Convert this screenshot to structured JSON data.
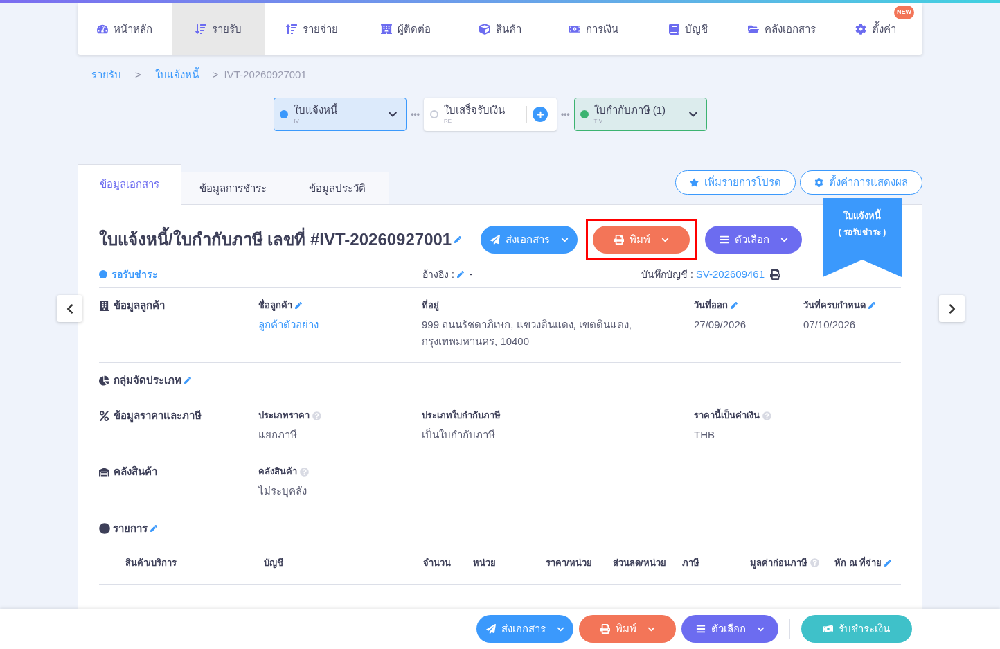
{
  "nav": {
    "items": [
      {
        "label": "หน้าหลัก",
        "selected": false
      },
      {
        "label": "รายรับ",
        "selected": true
      },
      {
        "label": "รายจ่าย",
        "selected": false
      },
      {
        "label": "ผู้ติดต่อ",
        "selected": false
      },
      {
        "label": "สินค้า",
        "selected": false
      },
      {
        "label": "การเงิน",
        "selected": false
      },
      {
        "label": "บัญชี",
        "selected": false
      },
      {
        "label": "คลังเอกสาร",
        "selected": false
      },
      {
        "label": "ตั้งค่า",
        "selected": false,
        "badge": "NEW"
      }
    ]
  },
  "breadcrumb": [
    {
      "label": "รายรับ",
      "kind": "link"
    },
    {
      "separator": ">",
      "label": "ใบแจ้งหนี้",
      "kind": "link"
    },
    {
      "separator": ">",
      "label": "IVT-20260927001",
      "kind": "current"
    }
  ],
  "doc_flow": [
    {
      "label": "ใบแจ้งหนี้",
      "code": "IV",
      "kind": "dropdown",
      "done": true,
      "color": "#3b99fc"
    },
    {
      "connector": "•••",
      "label": "ใบเสร็จรับเงิน",
      "code": "RE",
      "kind": "add",
      "done": false,
      "color": "#c8ccd8"
    },
    {
      "connector": "•••",
      "label": "ใบกำกับภาษี (1)",
      "code": "TIV",
      "kind": "dropdown",
      "done": true,
      "color": "#3cb371"
    }
  ],
  "tabs": [
    {
      "label": "ข้อมูลเอกสาร",
      "selected": true
    },
    {
      "label": "ข้อมูลการชำระ",
      "selected": false
    },
    {
      "label": "ข้อมูลประวัติ",
      "selected": false
    }
  ],
  "top_actions": [
    {
      "label": "เพิ่มรายการโปรด"
    },
    {
      "label": "ตั้งค่าการแสดงผล"
    }
  ],
  "ribbon": {
    "title": "ใบแจ้งหนี้",
    "status": "( รอรับชำระ )"
  },
  "document": {
    "title": "ใบแจ้งหนี้/ใบกำกับภาษี เลขที่ #IVT-20260927001",
    "actions": [
      {
        "label": "ส่งเอกสาร",
        "kind": "send",
        "highlighted": false
      },
      {
        "label": "พิมพ์",
        "kind": "print",
        "highlighted": true
      },
      {
        "label": "ตัวเลือก",
        "kind": "options",
        "highlighted": false
      }
    ],
    "status": {
      "label": "รอรับชำระ",
      "color": "#3b99fc"
    },
    "reference": {
      "label": "อ้างอิง :",
      "value": "-"
    },
    "ledger": {
      "label": "บันทึกบัญชี :",
      "value": "SV-202609461"
    }
  },
  "sections": [
    {
      "title": "ข้อมูลลูกค้า",
      "editable": false,
      "fields": [
        {
          "label": "ชื่อลูกค้า",
          "value": "ลูกค้าตัวอย่าง",
          "editable": true,
          "help": false,
          "link": true
        },
        {
          "label": "ที่อยู่",
          "value": "999 ถนนรัชดาภิเษก, แขวงดินแดง, เขตดินแดง, กรุงเทพมหานคร, 10400",
          "editable": false,
          "help": false,
          "link": false
        },
        {
          "label": "วันที่ออก",
          "value": "27/09/2026",
          "editable": true,
          "help": false,
          "link": false
        },
        {
          "label": "วันที่ครบกำหนด",
          "value": "07/10/2026",
          "editable": true,
          "help": false,
          "link": false
        }
      ]
    },
    {
      "title": "กลุ่มจัดประเภท",
      "editable": true
    },
    {
      "title": "ข้อมูลราคาและภาษี",
      "editable": false,
      "fields": [
        {
          "label": "ประเภทราคา",
          "value": "แยกภาษี",
          "editable": false,
          "help": true,
          "link": false
        },
        {
          "label": "ประเภทใบกำกับภาษี",
          "value": "เป็นใบกำกับภาษี",
          "editable": false,
          "help": false,
          "link": false
        },
        {
          "label": "ราคานี้เป็นค่าเงิน",
          "value": "THB",
          "editable": false,
          "help": true,
          "link": false
        }
      ]
    },
    {
      "title": "คลังสินค้า",
      "editable": false,
      "fields": [
        {
          "label": "คลังสินค้า",
          "value": "ไม่ระบุคลัง",
          "editable": false,
          "help": true,
          "link": false
        }
      ]
    }
  ],
  "items": {
    "title": "รายการ",
    "editable": true,
    "columns": [
      {
        "label": "สินค้า/บริการ",
        "help": false,
        "editable": false
      },
      {
        "label": "บัญชี",
        "help": false,
        "editable": false
      },
      {
        "label": "จำนวน",
        "help": false,
        "editable": false
      },
      {
        "label": "หน่วย",
        "help": false,
        "editable": false
      },
      {
        "label": "ราคา/หน่วย",
        "help": false,
        "editable": false
      },
      {
        "label": "ส่วนลด/หน่วย",
        "help": false,
        "editable": false
      },
      {
        "label": "ภาษี",
        "help": false,
        "editable": false
      },
      {
        "label": "มูลค่าก่อนภาษี",
        "help": true,
        "editable": false
      },
      {
        "label": "หัก ณ ที่จ่าย",
        "help": false,
        "editable": true
      }
    ]
  },
  "bottom_actions": [
    {
      "label": "ส่งเอกสาร",
      "kind": "send"
    },
    {
      "label": "พิมพ์",
      "kind": "print"
    },
    {
      "label": "ตัวเลือก",
      "kind": "options"
    },
    {
      "label": "รับชำระเงิน",
      "kind": "receive"
    }
  ]
}
